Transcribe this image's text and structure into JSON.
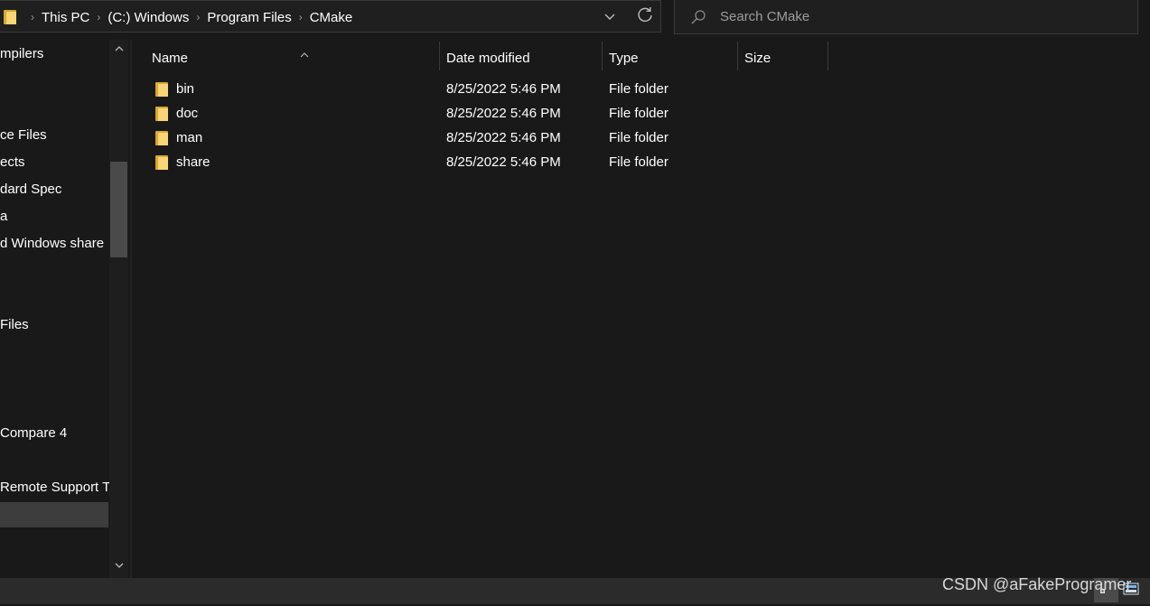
{
  "address": {
    "breadcrumbs": [
      "This PC",
      "(C:) Windows",
      "Program Files",
      "CMake"
    ],
    "separator": "›",
    "dropdown_icon": "chevron-down-icon",
    "refresh_icon": "refresh-icon"
  },
  "search": {
    "placeholder": "Search CMake"
  },
  "nav": {
    "items": [
      "mpilers",
      "ce Files",
      "ects",
      "dard Spec",
      "a",
      "d Windows share",
      " Files",
      " Compare 4",
      "Remote Support Tc"
    ]
  },
  "columns": {
    "name": "Name",
    "date": "Date modified",
    "type": "Type",
    "size": "Size"
  },
  "files": [
    {
      "name": "bin",
      "date": "8/25/2022 5:46 PM",
      "type": "File folder",
      "size": ""
    },
    {
      "name": "doc",
      "date": "8/25/2022 5:46 PM",
      "type": "File folder",
      "size": ""
    },
    {
      "name": "man",
      "date": "8/25/2022 5:46 PM",
      "type": "File folder",
      "size": ""
    },
    {
      "name": "share",
      "date": "8/25/2022 5:46 PM",
      "type": "File folder",
      "size": ""
    }
  ],
  "watermark": "CSDN @aFakeProgramer",
  "colors": {
    "background": "#191919",
    "folder": "#f8d577",
    "folder_dark": "#d9a833",
    "status_bar": "#2b2b2b"
  }
}
